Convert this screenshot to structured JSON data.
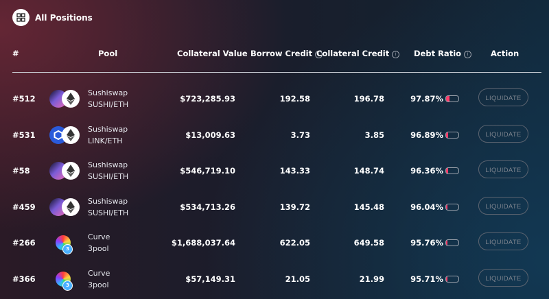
{
  "header": {
    "title": "All Positions",
    "icon": "grid-icon"
  },
  "table": {
    "columns": {
      "id": "#",
      "pool": "Pool",
      "collateral_value": "Collateral Value",
      "borrow_credit": "Borrow Credit",
      "collateral_credit": "Collateral Credit",
      "debt_ratio": "Debt Ratio",
      "action": "Action"
    },
    "info_icon": "i",
    "rows": [
      {
        "id": "#512",
        "protocol": "Sushiswap",
        "pair": "SUSHI/ETH",
        "token_icons": [
          "sushi-icon",
          "eth-icon"
        ],
        "collateral_value": "$723,285.93",
        "borrow_credit": "192.58",
        "collateral_credit": "196.78",
        "debt_ratio": "97.87%",
        "debt_ratio_level": 0.9787,
        "action": "LIQUIDATE"
      },
      {
        "id": "#531",
        "protocol": "Sushiswap",
        "pair": "LINK/ETH",
        "token_icons": [
          "link-icon",
          "eth-icon"
        ],
        "collateral_value": "$13,009.63",
        "borrow_credit": "3.73",
        "collateral_credit": "3.85",
        "debt_ratio": "96.89%",
        "debt_ratio_level": 0.9689,
        "action": "LIQUIDATE"
      },
      {
        "id": "#58",
        "protocol": "Sushiswap",
        "pair": "SUSHI/ETH",
        "token_icons": [
          "sushi-icon",
          "eth-icon"
        ],
        "collateral_value": "$546,719.10",
        "borrow_credit": "143.33",
        "collateral_credit": "148.74",
        "debt_ratio": "96.36%",
        "debt_ratio_level": 0.9636,
        "action": "LIQUIDATE"
      },
      {
        "id": "#459",
        "protocol": "Sushiswap",
        "pair": "SUSHI/ETH",
        "token_icons": [
          "sushi-icon",
          "eth-icon"
        ],
        "collateral_value": "$534,713.26",
        "borrow_credit": "139.72",
        "collateral_credit": "145.48",
        "debt_ratio": "96.04%",
        "debt_ratio_level": 0.9604,
        "action": "LIQUIDATE"
      },
      {
        "id": "#266",
        "protocol": "Curve",
        "pair": "3pool",
        "token_icons": [
          "curve-icon"
        ],
        "collateral_value": "$1,688,037.64",
        "borrow_credit": "622.05",
        "collateral_credit": "649.58",
        "debt_ratio": "95.76%",
        "debt_ratio_level": 0.9576,
        "action": "LIQUIDATE"
      },
      {
        "id": "#366",
        "protocol": "Curve",
        "pair": "3pool",
        "token_icons": [
          "curve-icon"
        ],
        "collateral_value": "$57,149.31",
        "borrow_credit": "21.05",
        "collateral_credit": "21.99",
        "debt_ratio": "95.71%",
        "debt_ratio_level": 0.9571,
        "action": "LIQUIDATE"
      }
    ]
  },
  "colors": {
    "accent": "#ff3e6c",
    "link": "#2a5ada"
  }
}
